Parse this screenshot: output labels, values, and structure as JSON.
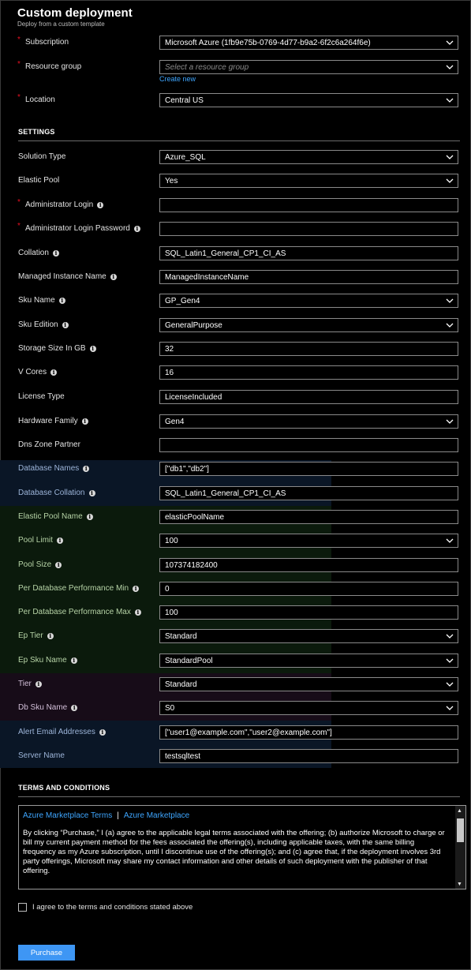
{
  "header": {
    "title": "Custom deployment",
    "subtitle": "Deploy from a custom template"
  },
  "basics": {
    "subscription": {
      "label": "Subscription",
      "value": "Microsoft Azure (1fb9e75b-0769-4d77-b9a2-6f2c6a264f6e)"
    },
    "resource_group": {
      "label": "Resource group",
      "placeholder": "Select a resource group",
      "create_new": "Create new"
    },
    "location": {
      "label": "Location",
      "value": "Central US"
    }
  },
  "settings": {
    "title": "SETTINGS",
    "fields": {
      "solution_type": {
        "label": "Solution Type",
        "value": "Azure_SQL"
      },
      "elastic_pool": {
        "label": "Elastic Pool",
        "value": "Yes"
      },
      "admin_login": {
        "label": "Administrator Login",
        "value": ""
      },
      "admin_password": {
        "label": "Administrator Login Password",
        "value": ""
      },
      "collation": {
        "label": "Collation",
        "value": "SQL_Latin1_General_CP1_CI_AS"
      },
      "managed_instance_name": {
        "label": "Managed Instance Name",
        "value": "ManagedInstanceName"
      },
      "sku_name": {
        "label": "Sku Name",
        "value": "GP_Gen4"
      },
      "sku_edition": {
        "label": "Sku Edition",
        "value": "GeneralPurpose"
      },
      "storage_size": {
        "label": "Storage Size In GB",
        "value": "32"
      },
      "v_cores": {
        "label": "V Cores",
        "value": "16"
      },
      "license_type": {
        "label": "License Type",
        "value": "LicenseIncluded"
      },
      "hardware_family": {
        "label": "Hardware Family",
        "value": "Gen4"
      },
      "dns_zone_partner": {
        "label": "Dns Zone Partner",
        "value": ""
      },
      "database_names": {
        "label": "Database Names",
        "value": "[\"db1\",\"db2\"]"
      },
      "database_collation": {
        "label": "Database Collation",
        "value": "SQL_Latin1_General_CP1_CI_AS"
      },
      "elastic_pool_name": {
        "label": "Elastic Pool Name",
        "value": "elasticPoolName"
      },
      "pool_limit": {
        "label": "Pool Limit",
        "value": "100"
      },
      "pool_size": {
        "label": "Pool Size",
        "value": "107374182400"
      },
      "per_db_min": {
        "label": "Per Database Performance Min",
        "value": "0"
      },
      "per_db_max": {
        "label": "Per Database Performance Max",
        "value": "100"
      },
      "ep_tier": {
        "label": "Ep Tier",
        "value": "Standard"
      },
      "ep_sku_name": {
        "label": "Ep Sku Name",
        "value": "StandardPool"
      },
      "tier": {
        "label": "Tier",
        "value": "Standard"
      },
      "db_sku_name": {
        "label": "Db Sku Name",
        "value": "S0"
      },
      "alert_emails": {
        "label": "Alert Email Addresses",
        "value": "[\"user1@example.com\",\"user2@example.com\"]"
      },
      "server_name": {
        "label": "Server Name",
        "value": "testsqltest"
      }
    }
  },
  "terms": {
    "title": "TERMS AND CONDITIONS",
    "link1": "Azure Marketplace Terms",
    "separator": "|",
    "link2": "Azure Marketplace",
    "body": "By clicking “Purchase,” I (a) agree to the applicable legal terms associated with the offering; (b) authorize Microsoft to charge or bill my current payment method for the fees associated the offering(s), including applicable taxes, with the same billing frequency as my Azure subscription, until I discontinue use of the offering(s); and (c) agree that, if the deployment involves 3rd party offerings, Microsoft may share my contact information and other details of such deployment with the publisher of that offering.",
    "agree_label": "I agree to the terms and conditions stated above"
  },
  "actions": {
    "purchase": "Purchase"
  }
}
